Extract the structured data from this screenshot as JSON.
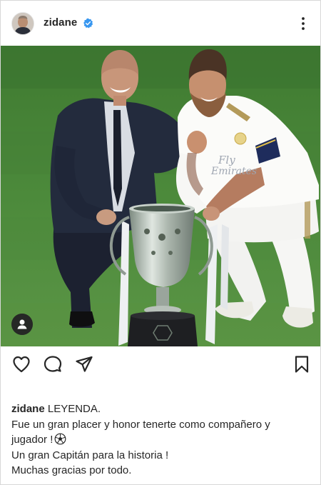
{
  "header": {
    "username": "zidane",
    "verified": true,
    "avatar_icon": "avatar-icon",
    "more_icon": "more-options-icon"
  },
  "post": {
    "image_icon": "post-photo",
    "user_tag_icon": "user-tag-icon"
  },
  "actions": {
    "like_icon": "heart-icon",
    "comment_icon": "comment-icon",
    "share_icon": "send-icon",
    "save_icon": "bookmark-icon"
  },
  "caption": {
    "username": "zidane",
    "line1": "LEYENDA.",
    "line2": "Fue un gran placer y honor tenerte como compañero y",
    "line3": "jugador !",
    "line4": "Un gran Capitán para la historia !",
    "line5": "Muchas gracias por todo.",
    "emoji_icon": "soccer-ball-icon"
  },
  "colors": {
    "text": "#262626",
    "verified_blue": "#3897f0",
    "pitch_green": "#4f8a3c"
  }
}
